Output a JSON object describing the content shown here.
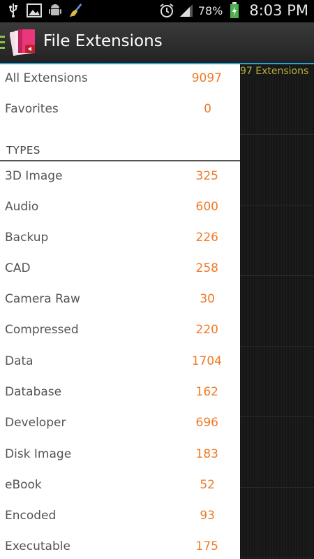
{
  "status_bar": {
    "icons_left": [
      "usb-icon",
      "image-icon",
      "android-icon",
      "broom-icon"
    ],
    "icons_right": [
      "alarm-icon",
      "signal-icon",
      "battery-icon"
    ],
    "battery": "78%",
    "time": "8:03 PM"
  },
  "app": {
    "title": "File Extensions"
  },
  "background": {
    "count_label": "97 Extensions"
  },
  "drawer": {
    "top_items": [
      {
        "label": "All Extensions",
        "count": "9097"
      },
      {
        "label": "Favorites",
        "count": "0"
      }
    ],
    "section_title": "TYPES",
    "types": [
      {
        "label": "3D Image",
        "count": "325"
      },
      {
        "label": "Audio",
        "count": "600"
      },
      {
        "label": "Backup",
        "count": "226"
      },
      {
        "label": "CAD",
        "count": "258"
      },
      {
        "label": "Camera Raw",
        "count": "30"
      },
      {
        "label": "Compressed",
        "count": "220"
      },
      {
        "label": "Data",
        "count": "1704"
      },
      {
        "label": "Database",
        "count": "162"
      },
      {
        "label": "Developer",
        "count": "696"
      },
      {
        "label": "Disk Image",
        "count": "183"
      },
      {
        "label": "eBook",
        "count": "52"
      },
      {
        "label": "Encoded",
        "count": "93"
      },
      {
        "label": "Executable",
        "count": "175"
      }
    ]
  },
  "colors": {
    "accent_blue": "#29a3d6",
    "count_orange": "#f07a27",
    "drawer_indicator_green": "#8bc34a"
  }
}
